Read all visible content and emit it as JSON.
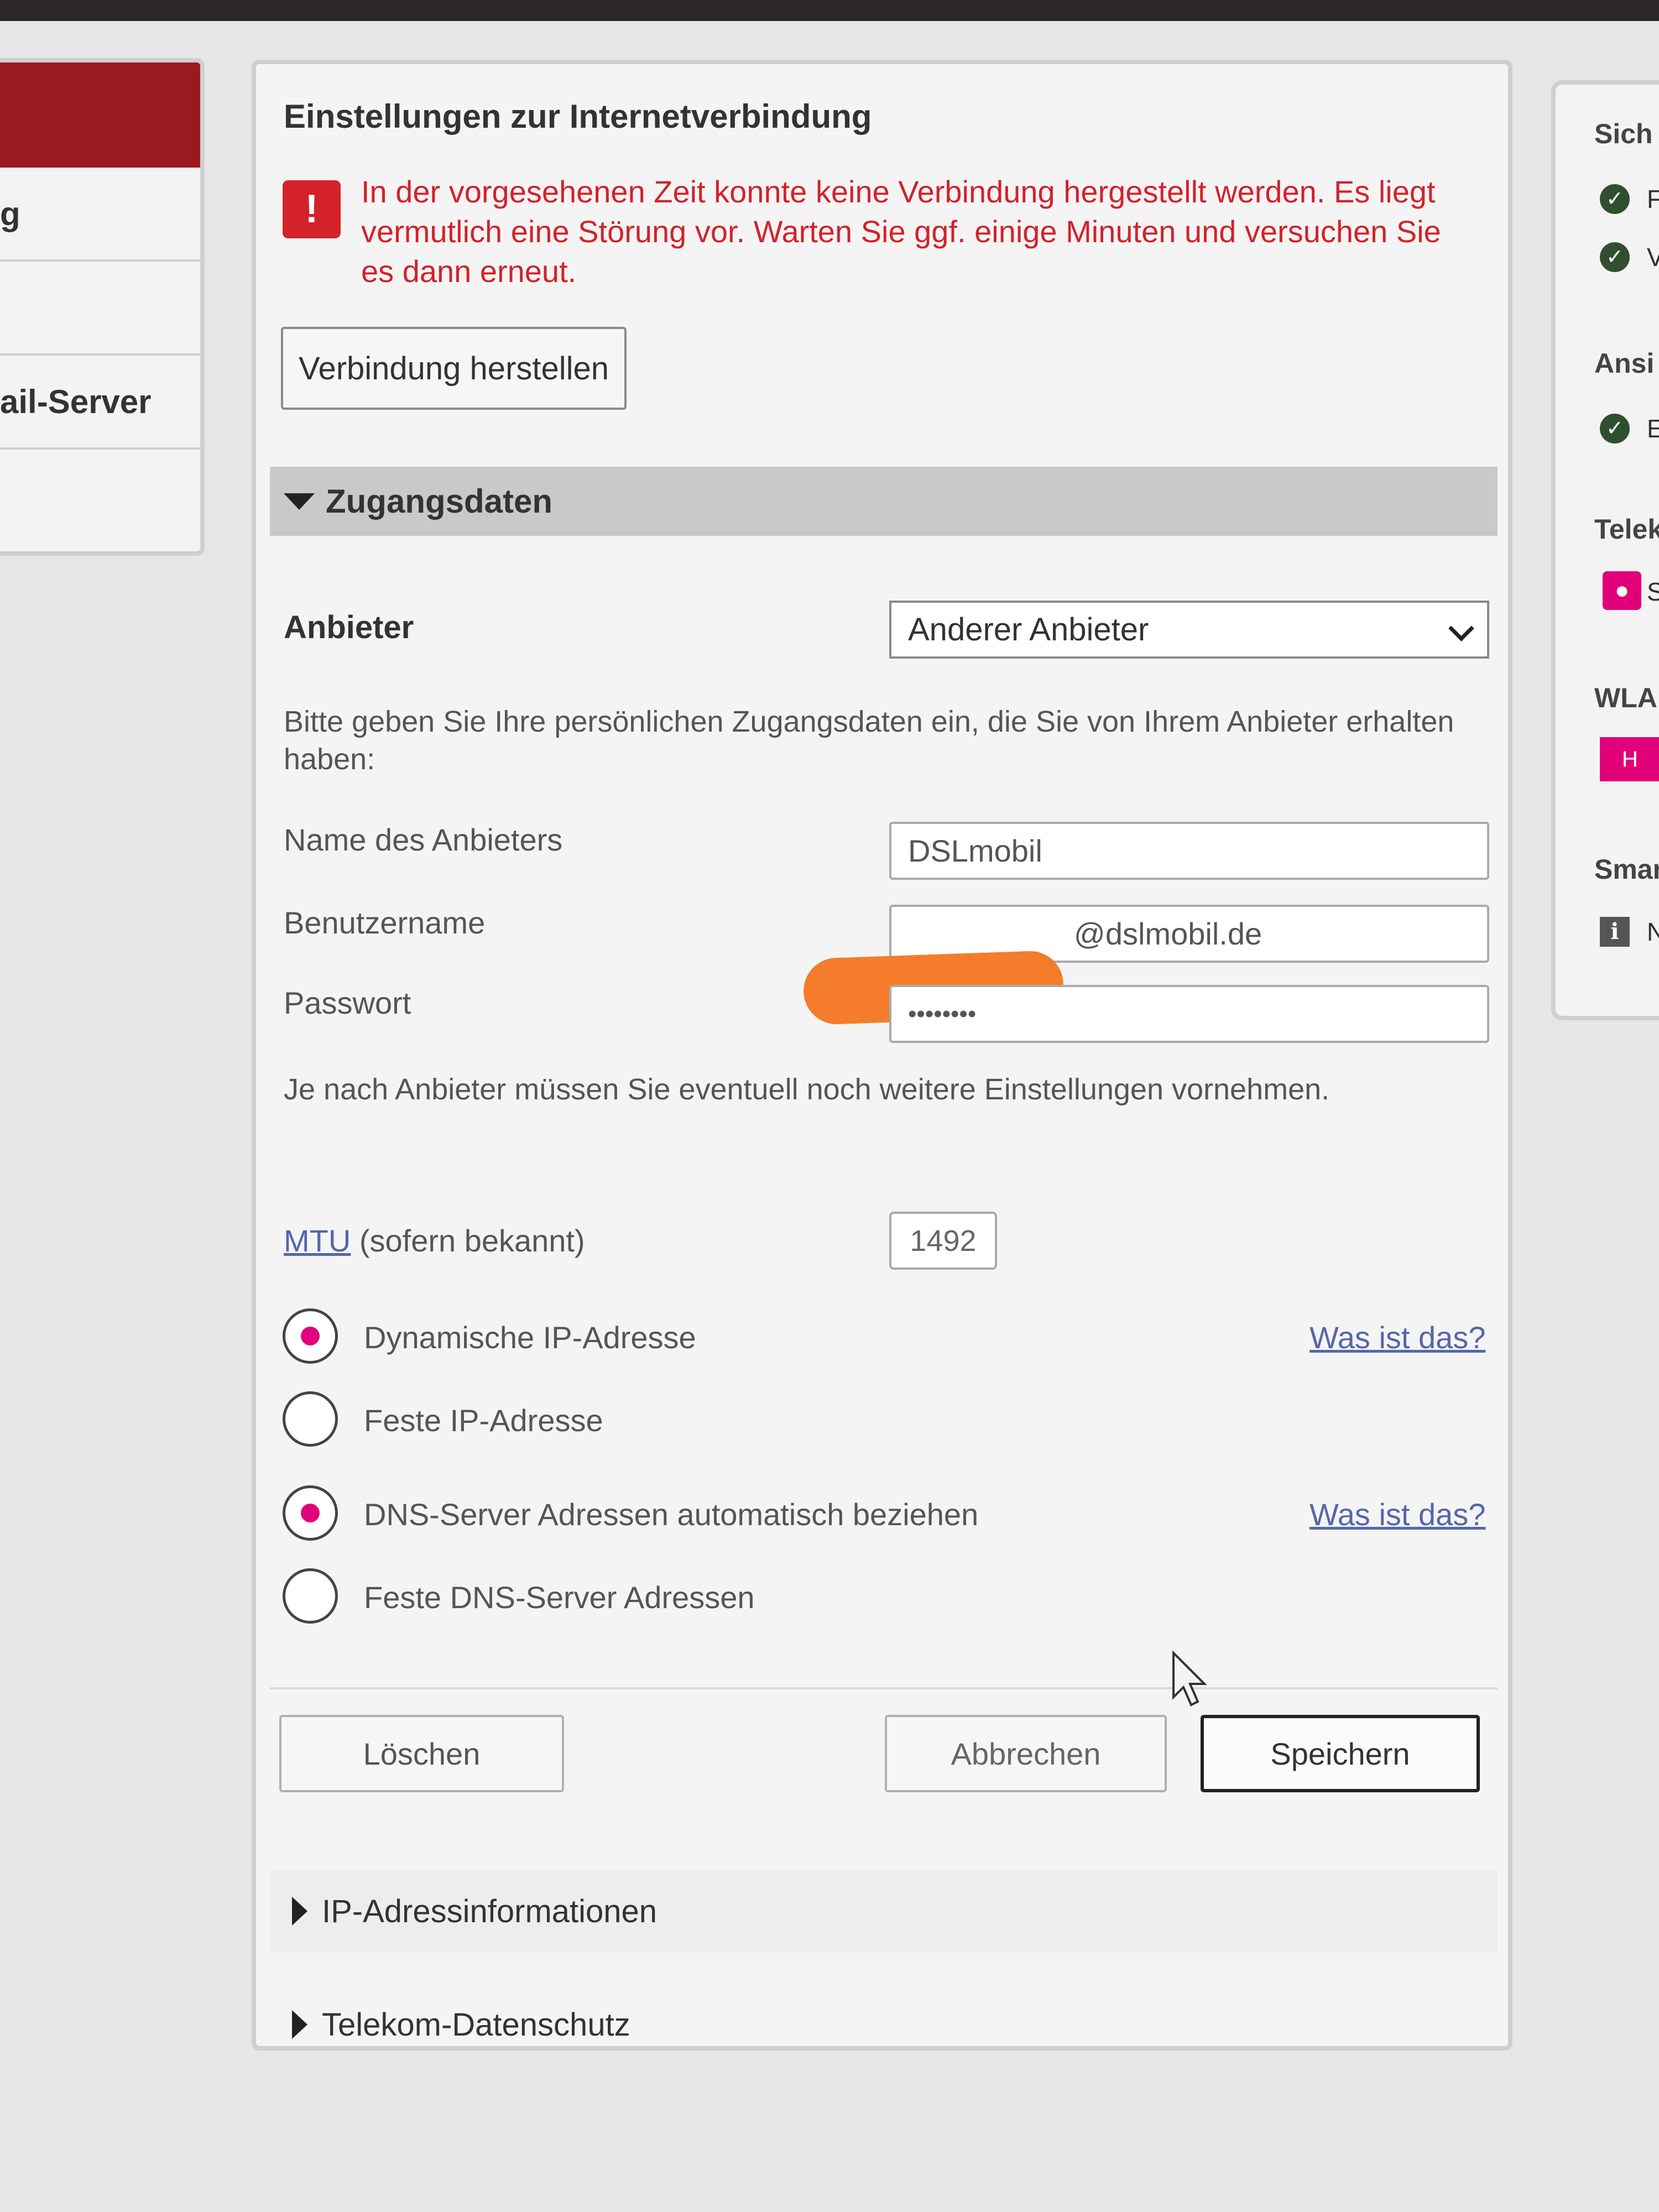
{
  "left_sidebar": {
    "items": [
      "g",
      "",
      "ail-Server",
      ""
    ]
  },
  "right_sidebar": {
    "headings": [
      "Sich",
      "Ansi",
      "Telek",
      "WLA",
      "Smar"
    ],
    "row_texts": [
      "F",
      "V",
      "E",
      "S",
      "H",
      "N"
    ],
    "icons": [
      "check-icon",
      "check-icon",
      "check-icon",
      "user-icon",
      "wifi-icon",
      "info-icon"
    ]
  },
  "main": {
    "title": "Einstellungen zur Internetverbindung",
    "error_message": "In der vorgesehenen Zeit konnte keine Verbindung hergestellt werden. Es liegt vermutlich eine Störung vor. Warten Sie ggf. einige Minuten und versuchen Sie es dann erneut.",
    "warning_symbol": "!",
    "connect_button": "Verbindung herstellen",
    "access_section": {
      "title": "Zugangsdaten",
      "provider_label": "Anbieter",
      "provider_value": "Anderer Anbieter",
      "intro_text": "Bitte geben Sie Ihre persönlichen Zugangsdaten ein, die Sie von Ihrem Anbieter erhalten haben:",
      "provider_name_label": "Name des Anbieters",
      "provider_name_value": "DSLmobil",
      "username_label": "Benutzername",
      "username_value_visible": "@dslmobil.de",
      "password_label": "Passwort",
      "password_value": "••••••••",
      "extra_settings_hint": "Je nach Anbieter müssen Sie eventuell noch weitere Einstellungen vornehmen.",
      "mtu_link": "MTU",
      "mtu_label_suffix": "(sofern bekannt)",
      "mtu_value": "1492",
      "ip_options": [
        {
          "label": "Dynamische IP-Adresse",
          "selected": true
        },
        {
          "label": "Feste IP-Adresse",
          "selected": false
        }
      ],
      "dns_options": [
        {
          "label": "DNS-Server Adressen automatisch beziehen",
          "selected": true
        },
        {
          "label": "Feste DNS-Server Adressen",
          "selected": false
        }
      ],
      "help_link": "Was ist das?"
    },
    "buttons": {
      "delete": "Löschen",
      "cancel": "Abbrechen",
      "save": "Speichern"
    },
    "collapsed_sections": [
      "IP-Adressinformationen",
      "Telekom-Datenschutz"
    ]
  },
  "colors": {
    "accent_magenta": "#e2007a",
    "error_red": "#d3222a",
    "sidebar_active": "#9b1a20",
    "redaction_orange": "#f47c2a"
  }
}
